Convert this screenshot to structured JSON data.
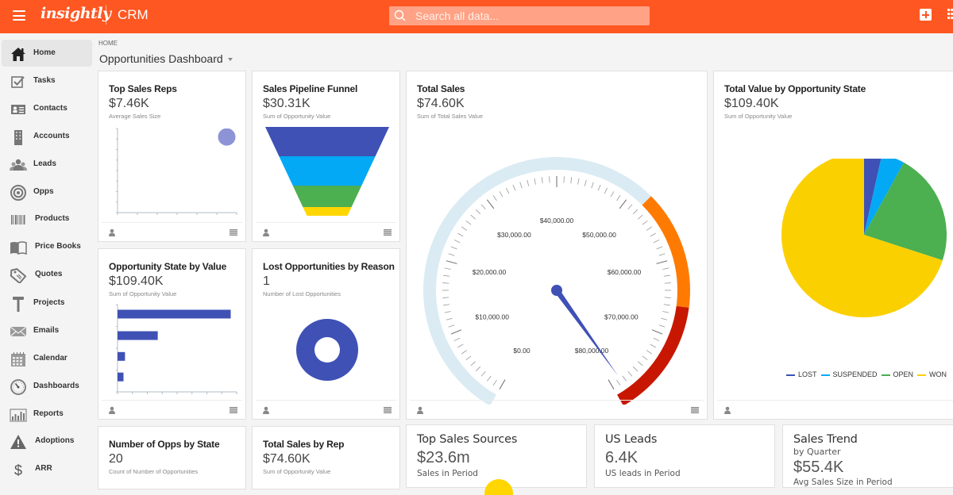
{
  "topbar": {
    "brand": "insightly",
    "app_name": "CRM",
    "search_placeholder": "Search all data...",
    "brand_color": "#ff5722"
  },
  "sidebar": {
    "items": [
      {
        "label": "Home",
        "icon": "home-icon",
        "active": true
      },
      {
        "label": "Tasks",
        "icon": "tasks-checkbox-icon"
      },
      {
        "label": "Contacts",
        "icon": "contact-card-icon"
      },
      {
        "label": "Accounts",
        "icon": "building-icon"
      },
      {
        "label": "Leads",
        "icon": "people-icon"
      },
      {
        "label": "Opps",
        "icon": "target-icon"
      },
      {
        "label": "Products",
        "icon": "barcode-icon"
      },
      {
        "label": "Price Books",
        "icon": "book-icon"
      },
      {
        "label": "Quotes",
        "icon": "tag-icon"
      },
      {
        "label": "Projects",
        "icon": "hammer-icon"
      },
      {
        "label": "Emails",
        "icon": "envelope-icon"
      },
      {
        "label": "Calendar",
        "icon": "calendar-icon"
      },
      {
        "label": "Dashboards",
        "icon": "gauge-icon"
      },
      {
        "label": "Reports",
        "icon": "bar-chart-icon"
      },
      {
        "label": "Adoptions",
        "icon": "warning-icon"
      },
      {
        "label": "ARR",
        "icon": "dollar-icon"
      }
    ]
  },
  "header": {
    "breadcrumb": "HOME",
    "title": "Opportunities Dashboard"
  },
  "cards": {
    "top_sales_reps": {
      "title": "Top Sales Reps",
      "value": "$7.46K",
      "subtitle": "Average Sales Size"
    },
    "pipeline_funnel": {
      "title": "Sales Pipeline Funnel",
      "value": "$30.31K",
      "subtitle": "Sum of Opportunity Value"
    },
    "total_sales": {
      "title": "Total Sales",
      "value": "$74.60K",
      "subtitle": "Sum of Total Sales Value"
    },
    "value_by_state": {
      "title": "Total Value by Opportunity State",
      "value": "$109.40K",
      "subtitle": "Sum of Opportunity Value"
    },
    "opp_state_by_value": {
      "title": "Opportunity State by Value",
      "value": "$109.40K",
      "subtitle": "Sum of Opportunity Value"
    },
    "lost_by_reason": {
      "title": "Lost Opportunities by Reason",
      "value": "1",
      "subtitle": "Number of Lost Opportunities"
    },
    "opps_by_state": {
      "title": "Number of Opps by State",
      "value": "20",
      "subtitle": "Count of Number of Opportunities"
    },
    "sales_by_rep": {
      "title": "Total Sales by Rep",
      "value": "$74.60K",
      "subtitle": "Sum of Opportunity Value"
    },
    "top_sales_sources": {
      "title": "Top Sales Sources",
      "value": "$23.6m",
      "subtitle": "Sales in Period"
    },
    "us_leads": {
      "title": "US Leads",
      "value": "6.4K",
      "subtitle": "US leads in Period"
    },
    "sales_trend": {
      "title": "Sales Trend",
      "subtitle_top": "by Quarter",
      "value": "$55.4K",
      "subtitle": "Avg Sales Size in Period"
    }
  },
  "chart_data": [
    {
      "id": "top_sales_reps",
      "type": "scatter",
      "points": [
        {
          "x": 5.5,
          "y": 7.5
        }
      ],
      "xlim": [
        0,
        6
      ],
      "ylim": [
        0,
        8
      ],
      "color": "#8c94d6"
    },
    {
      "id": "pipeline_funnel",
      "type": "funnel",
      "values": [
        40,
        30,
        20,
        8
      ],
      "colors": [
        "#3f51b5",
        "#03a9f4",
        "#4caf50",
        "#ffd600"
      ]
    },
    {
      "id": "total_sales",
      "type": "gauge",
      "value": 78500,
      "min": 0,
      "max": 80000,
      "tick_labels": [
        "$0.00",
        "$10,000.00",
        "$20,000.00",
        "$30,000.00",
        "$40,000.00",
        "$50,000.00",
        "$60,000.00",
        "$70,000.00",
        "$80,000.00"
      ],
      "bands": [
        {
          "from": 0,
          "to": 52000,
          "color": "#daebf3"
        },
        {
          "from": 52000,
          "to": 66000,
          "color": "#ff7a00"
        },
        {
          "from": 66000,
          "to": 80000,
          "color": "#c81700"
        }
      ],
      "needle_color": "#3f51b5"
    },
    {
      "id": "value_by_state",
      "type": "pie",
      "labels": [
        "LOST",
        "SUSPENDED",
        "OPEN",
        "WON"
      ],
      "values": [
        3.5,
        4.5,
        22,
        70
      ],
      "colors": [
        "#3f51b5",
        "#03a9f4",
        "#4caf50",
        "#fbd000"
      ],
      "legend": "bottom"
    },
    {
      "id": "opp_state_by_value",
      "type": "bar",
      "orientation": "horizontal",
      "values": [
        76,
        27,
        5,
        4
      ],
      "xlim": [
        0,
        80
      ],
      "color": "#3f51b5"
    },
    {
      "id": "lost_by_reason",
      "type": "pie",
      "donut": true,
      "values": [
        1
      ],
      "colors": [
        "#3f51b5"
      ]
    }
  ]
}
